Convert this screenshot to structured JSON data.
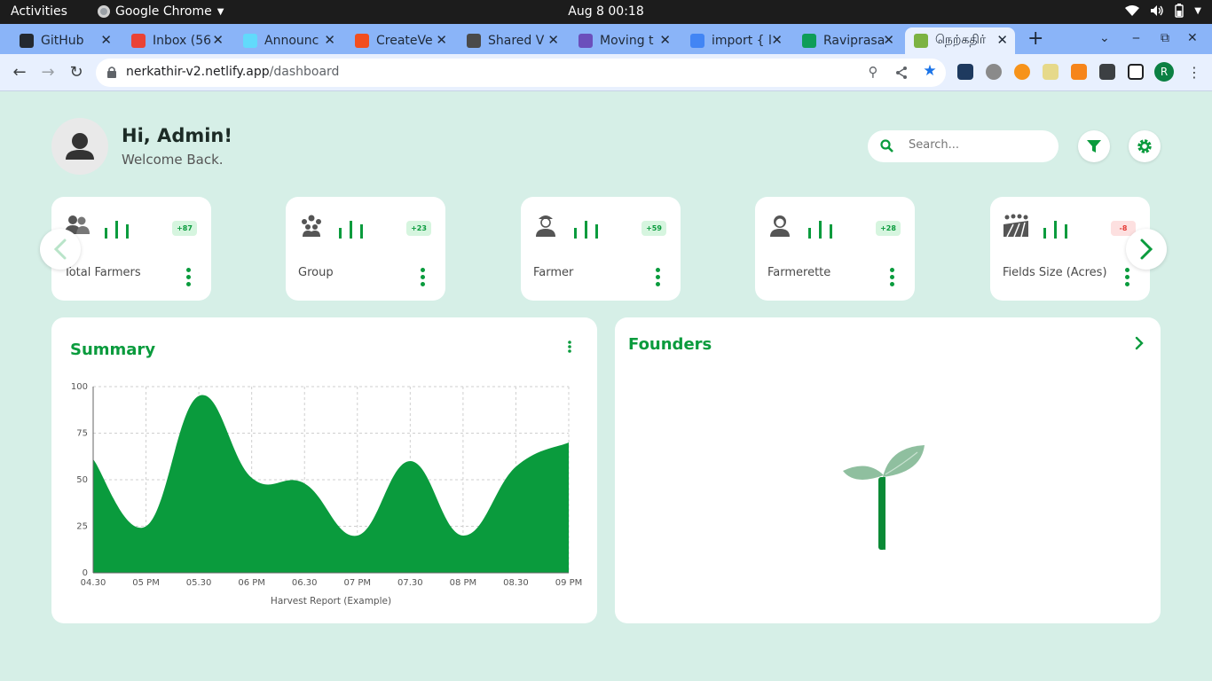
{
  "os": {
    "activities": "Activities",
    "app_name": "Google Chrome",
    "clock": "Aug 8  00:18"
  },
  "tabs": [
    {
      "title": "GitHub",
      "color": "#24292f"
    },
    {
      "title": "Inbox (56",
      "color": "#ea4335"
    },
    {
      "title": "Announc",
      "color": "#61dafb"
    },
    {
      "title": "CreateVe",
      "color": "#f24e1e"
    },
    {
      "title": "Shared V",
      "color": "#4a4a4a"
    },
    {
      "title": "Moving t",
      "color": "#6b4fbb"
    },
    {
      "title": "import { l",
      "color": "#4285f4"
    },
    {
      "title": "Raviprasa",
      "color": "#0f9d58"
    },
    {
      "title": "நெற்கதிர்",
      "color": "#7cb342",
      "active": true
    }
  ],
  "toolbar": {
    "url_host": "nerkathir-v2.netlify.app",
    "url_path": "/dashboard",
    "profile_initial": "R"
  },
  "header": {
    "greeting": "Hi, Admin!",
    "welcome": "Welcome Back.",
    "search_placeholder": "Search..."
  },
  "stats": [
    {
      "label": "Total Farmers",
      "badge": "+87",
      "trend": "up",
      "icon": "users-icon"
    },
    {
      "label": "Group",
      "badge": "+23",
      "trend": "up",
      "icon": "group-icon"
    },
    {
      "label": "Farmer",
      "badge": "+59",
      "trend": "up",
      "icon": "farmer-icon"
    },
    {
      "label": "Farmerette",
      "badge": "+28",
      "trend": "up",
      "icon": "farmerette-icon"
    },
    {
      "label": "Fields Size (Acres)",
      "badge": "-8",
      "trend": "down",
      "icon": "fields-icon"
    }
  ],
  "summary": {
    "title": "Summary"
  },
  "founders": {
    "title": "Founders"
  },
  "colors": {
    "accent": "#0a9b3d",
    "badge_up_bg": "#d6f5df",
    "badge_down_bg": "#fde0e0",
    "badge_down_text": "#e53935",
    "page_bg": "#d6efe7"
  },
  "chart_data": {
    "type": "area",
    "x": [
      "04.30",
      "05 PM",
      "05.30",
      "06 PM",
      "06.30",
      "07 PM",
      "07.30",
      "08 PM",
      "08.30",
      "09 PM"
    ],
    "series": [
      {
        "values": [
          61,
          25,
          95,
          51,
          48,
          20,
          60,
          20,
          57,
          70
        ]
      }
    ],
    "xlabel": "Harvest Report (Example)",
    "ylabel": "",
    "ylim": [
      0,
      100
    ],
    "yticks": [
      0,
      25,
      50,
      75,
      100
    ],
    "grid": true,
    "color": "#0a9b3d"
  }
}
